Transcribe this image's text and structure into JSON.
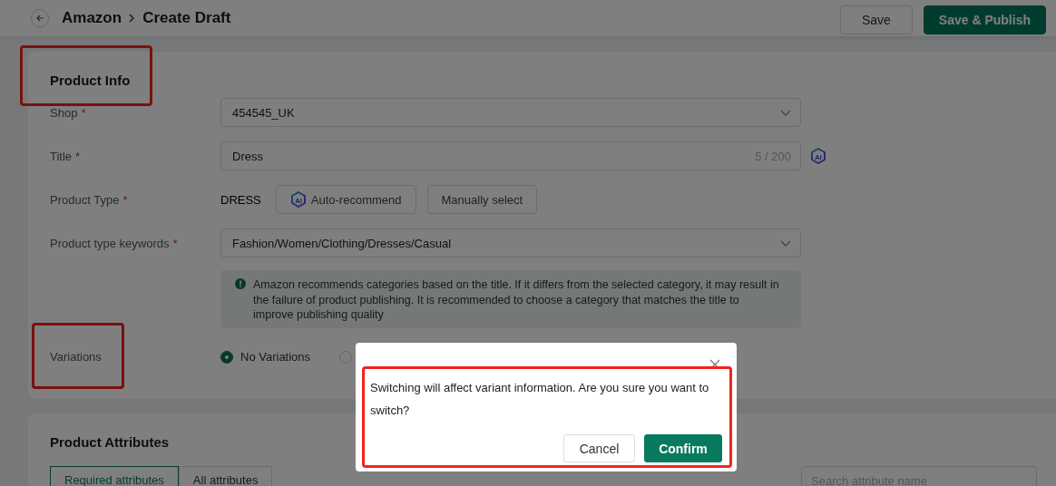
{
  "header": {
    "breadcrumb": [
      "Amazon",
      "Create Draft"
    ],
    "buttons": [
      {
        "label": "Save",
        "kind": "secondary"
      },
      {
        "label": "Save & Publish",
        "kind": "primary"
      }
    ]
  },
  "product_info": {
    "title": "Product Info",
    "highlighted": true,
    "fields": [
      {
        "kind": "select",
        "label": "Shop",
        "mark": "*",
        "value": "454545_UK"
      },
      {
        "kind": "text",
        "label": "Title",
        "mark": "*",
        "value": "Dress",
        "counter": "5 / 200",
        "ai_icon": "AI"
      },
      {
        "kind": "type",
        "label": "Product Type",
        "mark": "*",
        "value": "DRESS",
        "buttons": [
          {
            "label": "Auto-recommend",
            "icon": "AI"
          },
          {
            "label": "Manually select"
          }
        ]
      },
      {
        "kind": "select",
        "label": "Product type keywords",
        "mark": "*",
        "value": "Fashion/Women/Clothing/Dresses/Casual"
      },
      {
        "kind": "notice",
        "text": "Amazon recommends categories based on the title. If it differs from the selected category, it may result in the failure of product publishing. It is recommended to choose a category that matches the title to improve publishing quality"
      },
      {
        "kind": "radio",
        "label": "Variations",
        "highlighted": true,
        "options": [
          {
            "label": "No Variations",
            "selected": true
          },
          {
            "selected": false
          }
        ]
      }
    ]
  },
  "product_attributes": {
    "title": "Product Attributes",
    "tabs": [
      {
        "label": "Required attributes",
        "selected": true
      },
      {
        "label": "All attributes",
        "selected": false
      }
    ],
    "search": {
      "placeholder": "Search attribute name"
    }
  },
  "dialog": {
    "message": "Switching will affect variant information. Are you sure you want to switch?",
    "highlighted": true,
    "buttons": [
      {
        "label": "Cancel",
        "kind": "secondary"
      },
      {
        "label": "Confirm",
        "kind": "primary"
      }
    ]
  }
}
